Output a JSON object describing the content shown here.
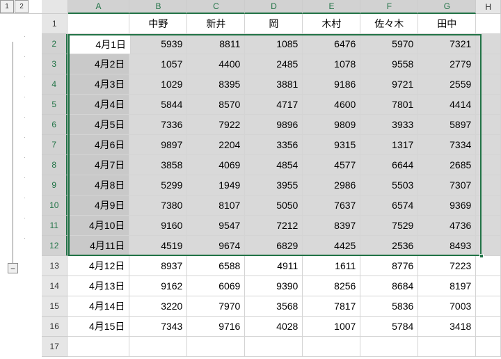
{
  "outline": {
    "level1": "1",
    "level2": "2",
    "collapse": "−"
  },
  "columns": [
    "A",
    "B",
    "C",
    "D",
    "E",
    "F",
    "G",
    "H"
  ],
  "headers": [
    "",
    "中野",
    "新井",
    "岡",
    "木村",
    "佐々木",
    "田中"
  ],
  "rows": [
    {
      "n": "1"
    },
    {
      "n": "2",
      "date": "4月1日",
      "v": [
        "5939",
        "8811",
        "1085",
        "6476",
        "5970",
        "7321"
      ],
      "sel": true
    },
    {
      "n": "3",
      "date": "4月2日",
      "v": [
        "1057",
        "4400",
        "2485",
        "1078",
        "9558",
        "2779"
      ],
      "sel": true
    },
    {
      "n": "4",
      "date": "4月3日",
      "v": [
        "1029",
        "8395",
        "3881",
        "9186",
        "9721",
        "2559"
      ],
      "sel": true
    },
    {
      "n": "5",
      "date": "4月4日",
      "v": [
        "5844",
        "8570",
        "4717",
        "4600",
        "7801",
        "4414"
      ],
      "sel": true
    },
    {
      "n": "6",
      "date": "4月5日",
      "v": [
        "7336",
        "7922",
        "9896",
        "9809",
        "3933",
        "5897"
      ],
      "sel": true
    },
    {
      "n": "7",
      "date": "4月6日",
      "v": [
        "9897",
        "2204",
        "3356",
        "9315",
        "1317",
        "7334"
      ],
      "sel": true
    },
    {
      "n": "8",
      "date": "4月7日",
      "v": [
        "3858",
        "4069",
        "4854",
        "4577",
        "6644",
        "2685"
      ],
      "sel": true
    },
    {
      "n": "9",
      "date": "4月8日",
      "v": [
        "5299",
        "1949",
        "3955",
        "2986",
        "5503",
        "7307"
      ],
      "sel": true
    },
    {
      "n": "10",
      "date": "4月9日",
      "v": [
        "7380",
        "8107",
        "5050",
        "7637",
        "6574",
        "9369"
      ],
      "sel": true
    },
    {
      "n": "11",
      "date": "4月10日",
      "v": [
        "9160",
        "9547",
        "7212",
        "8397",
        "7529",
        "4736"
      ],
      "sel": true
    },
    {
      "n": "12",
      "date": "4月11日",
      "v": [
        "4519",
        "9674",
        "6829",
        "4425",
        "2536",
        "8493"
      ],
      "sel": true
    },
    {
      "n": "13",
      "date": "4月12日",
      "v": [
        "8937",
        "6588",
        "4911",
        "1611",
        "8776",
        "7223"
      ]
    },
    {
      "n": "14",
      "date": "4月13日",
      "v": [
        "9162",
        "6069",
        "9390",
        "8256",
        "8684",
        "8197"
      ]
    },
    {
      "n": "15",
      "date": "4月14日",
      "v": [
        "3220",
        "7970",
        "3568",
        "7817",
        "5836",
        "7003"
      ]
    },
    {
      "n": "16",
      "date": "4月15日",
      "v": [
        "7343",
        "9716",
        "4028",
        "1007",
        "5784",
        "3418"
      ]
    },
    {
      "n": "17"
    }
  ],
  "active_cell": "4月1日",
  "colwidths": {
    "A": 90,
    "B": 84,
    "C": 84,
    "D": 84,
    "E": 84,
    "F": 84,
    "G": 84,
    "H": 36
  }
}
